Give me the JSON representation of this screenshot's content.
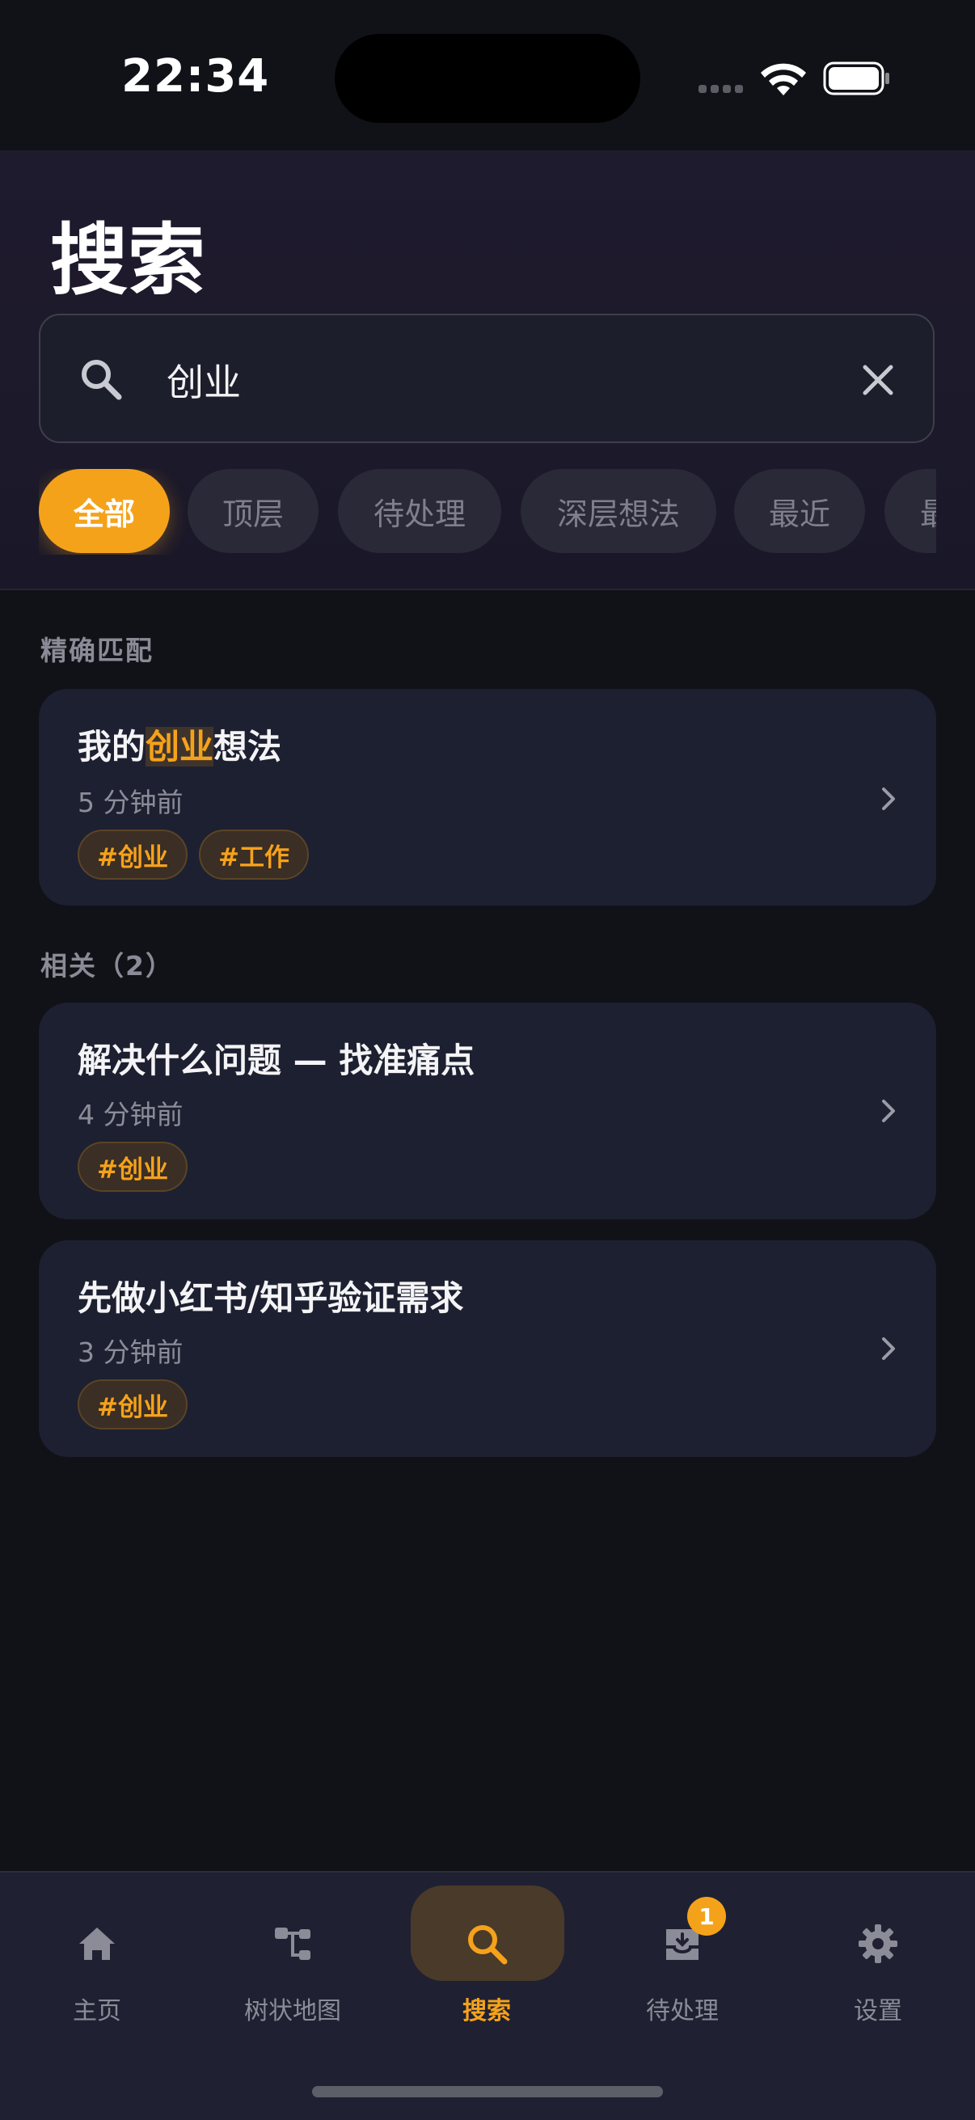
{
  "status_bar": {
    "time": "22:34"
  },
  "header": {
    "title": "搜索",
    "search": {
      "value": "创业",
      "placeholder": ""
    },
    "filters": [
      {
        "label": "全部",
        "active": true
      },
      {
        "label": "顶层",
        "active": false
      },
      {
        "label": "待处理",
        "active": false
      },
      {
        "label": "深层想法",
        "active": false
      },
      {
        "label": "最近",
        "active": false
      },
      {
        "label": "最",
        "active": false
      }
    ]
  },
  "exact": {
    "label": "精确匹配",
    "result": {
      "title_before": "我的",
      "title_highlight": "创业",
      "title_after": "想法",
      "time": "5 分钟前",
      "tags": [
        "#创业",
        "#工作"
      ]
    }
  },
  "related": {
    "label": "相关（2）",
    "items": [
      {
        "title": "解决什么问题 — 找准痛点",
        "time": "4 分钟前",
        "tags": [
          "#创业"
        ]
      },
      {
        "title": "先做小红书/知乎验证需求",
        "time": "3 分钟前",
        "tags": [
          "#创业"
        ]
      }
    ]
  },
  "tabbar": {
    "tabs": [
      {
        "label": "主页",
        "icon": "home-icon"
      },
      {
        "label": "树状地图",
        "icon": "tree-map-icon"
      },
      {
        "label": "搜索",
        "icon": "search-icon",
        "active": true
      },
      {
        "label": "待处理",
        "icon": "inbox-icon",
        "badge": "1"
      },
      {
        "label": "设置",
        "icon": "gear-icon"
      }
    ]
  },
  "colors": {
    "accent": "#f5a21b",
    "background": "#111217",
    "card": "#1d2030"
  }
}
